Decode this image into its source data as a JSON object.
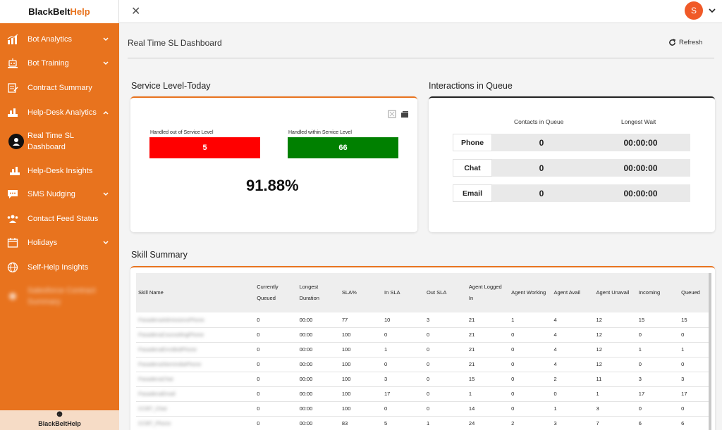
{
  "brand": {
    "part1": "BlackBelt",
    "part2": "Help"
  },
  "sidebar": {
    "items": [
      {
        "label": "Bot Analytics",
        "icon": "bar-chart-icon",
        "chevron": "down"
      },
      {
        "label": "Bot Training",
        "icon": "robot-icon",
        "chevron": "down"
      },
      {
        "label": "Contract Summary",
        "icon": "document-icon",
        "chevron": ""
      },
      {
        "label": "Help-Desk Analytics",
        "icon": "bar-chart-icon",
        "chevron": "up"
      },
      {
        "label": "Real Time SL Dashboard",
        "icon": "gauge-icon",
        "chevron": ""
      },
      {
        "label": "Help-Desk Insights",
        "icon": "bar-chart-icon",
        "chevron": ""
      },
      {
        "label": "SMS Nudging",
        "icon": "chat-icon",
        "chevron": "down"
      },
      {
        "label": "Contact Feed Status",
        "icon": "users-icon",
        "chevron": ""
      },
      {
        "label": "Holidays",
        "icon": "calendar-icon",
        "chevron": "down"
      },
      {
        "label": "Self-Help Insights",
        "icon": "globe-icon",
        "chevron": ""
      },
      {
        "label": "Salesforce Contract Summary",
        "icon": "document-icon",
        "chevron": ""
      }
    ],
    "footer": "BlackBeltHelp"
  },
  "topbar": {
    "avatar_initial": "S"
  },
  "page": {
    "title": "Real Time SL Dashboard",
    "refresh_label": "Refresh"
  },
  "service_level": {
    "title": "Service Level-Today",
    "out_label": "Handled out of Service Level",
    "out_value": "5",
    "within_label": "Handled within Service Level",
    "within_value": "66",
    "percent": "91.88%",
    "colors": {
      "out": "#ff0000",
      "within": "#008000"
    }
  },
  "queue": {
    "title": "Interactions in Queue",
    "col1": "Contacts in Queue",
    "col2": "Longest Wait",
    "rows": [
      {
        "label": "Phone",
        "contacts": "0",
        "wait": "00:00:00"
      },
      {
        "label": "Chat",
        "contacts": "0",
        "wait": "00:00:00"
      },
      {
        "label": "Email",
        "contacts": "0",
        "wait": "00:00:00"
      }
    ]
  },
  "skill_summary": {
    "title": "Skill Summary",
    "headers": [
      "Skill Name",
      "Currently Queued",
      "Longest Duration",
      "SLA%",
      "In SLA",
      "Out SLA",
      "Agent Logged In",
      "Agent Working",
      "Agent Avail",
      "Agent Unavail",
      "Incoming",
      "Queued"
    ],
    "rows": [
      [
        "PasadenaAdmissionsPhone",
        "0",
        "00:00",
        "77",
        "10",
        "3",
        "21",
        "1",
        "4",
        "12",
        "15",
        "15"
      ],
      [
        "PasadenaCounselingPhone",
        "0",
        "00:00",
        "100",
        "0",
        "0",
        "21",
        "0",
        "4",
        "12",
        "0",
        "0"
      ],
      [
        "PasadenaEnrolledPhone",
        "0",
        "00:00",
        "100",
        "1",
        "0",
        "21",
        "0",
        "4",
        "12",
        "1",
        "1"
      ],
      [
        "PasadenaStemIndiaPhone",
        "0",
        "00:00",
        "100",
        "0",
        "0",
        "21",
        "0",
        "4",
        "12",
        "0",
        "0"
      ],
      [
        "PasadenaChat",
        "0",
        "00:00",
        "100",
        "3",
        "0",
        "15",
        "0",
        "2",
        "11",
        "3",
        "3"
      ],
      [
        "PasadenaEmail",
        "0",
        "00:00",
        "100",
        "17",
        "0",
        "1",
        "0",
        "0",
        "1",
        "17",
        "17"
      ],
      [
        "CCBT_Chat",
        "0",
        "00:00",
        "100",
        "0",
        "0",
        "14",
        "0",
        "1",
        "3",
        "0",
        "0"
      ],
      [
        "CCBT_Phone",
        "0",
        "00:00",
        "83",
        "5",
        "1",
        "24",
        "2",
        "3",
        "7",
        "6",
        "6"
      ]
    ]
  }
}
